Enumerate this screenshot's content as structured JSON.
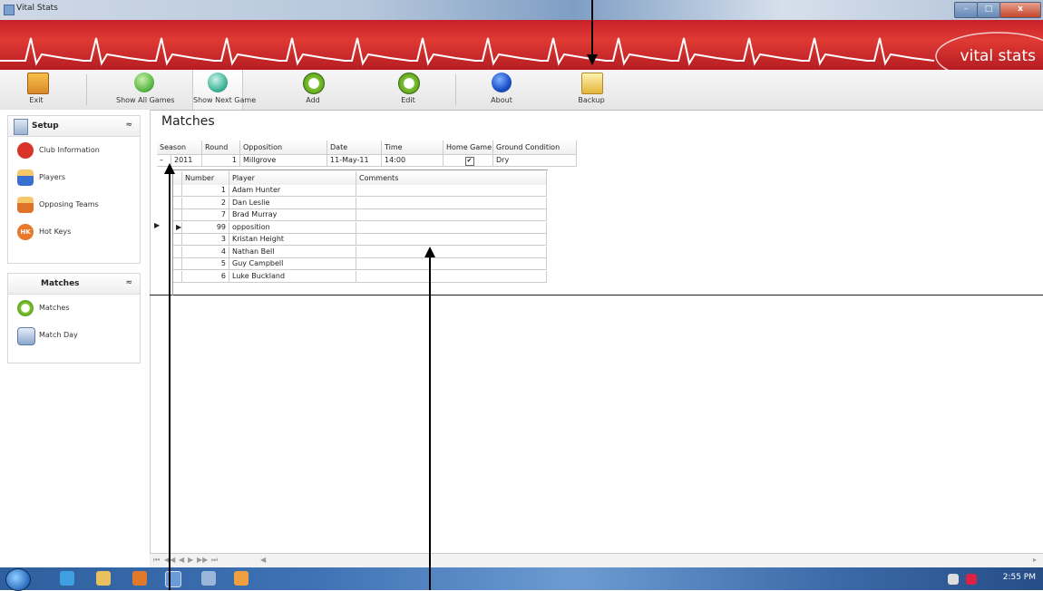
{
  "window": {
    "title": "Vital Stats",
    "min": "–",
    "max": "□",
    "close": "x"
  },
  "banner": {
    "logo_text": "vital stats",
    "color": "#d42a2a"
  },
  "toolbar": {
    "exit": "Exit",
    "show_all_games": "Show All Games",
    "show_next_game": "Show Next Game",
    "add": "Add",
    "edit": "Edit",
    "about": "About",
    "backup": "Backup"
  },
  "sidebar": {
    "setup": {
      "title": "Setup",
      "items": [
        {
          "label": "Club Information",
          "icon": "club-icon"
        },
        {
          "label": "Players",
          "icon": "players-icon"
        },
        {
          "label": "Opposing Teams",
          "icon": "teams-icon"
        },
        {
          "label": "Hot Keys",
          "icon": "hotkeys-icon",
          "badge": "HK"
        }
      ]
    },
    "matches": {
      "title": "Matches",
      "items": [
        {
          "label": "Matches",
          "icon": "clock-icon"
        },
        {
          "label": "Match Day",
          "icon": "calendar-icon"
        }
      ]
    },
    "chevron": "≈"
  },
  "main": {
    "title": "Matches",
    "columns": [
      "Season",
      "Round",
      "Opposition",
      "Date",
      "Time",
      "Home Game",
      "Ground Condition"
    ],
    "match": {
      "expander": "–",
      "season": "2011",
      "round": "1",
      "opposition": "Millgrove",
      "date": "11-May-11",
      "time": "14:00",
      "home_game": "✔",
      "ground_condition": "Dry"
    },
    "detail_columns": [
      "Number",
      "Player",
      "Comments"
    ],
    "players": [
      {
        "number": "1",
        "player": "Adam Hunter",
        "comments": ""
      },
      {
        "number": "2",
        "player": "Dan Leslie",
        "comments": ""
      },
      {
        "number": "7",
        "player": "Brad Murray",
        "comments": ""
      },
      {
        "number": "99",
        "player": "opposition",
        "comments": ""
      },
      {
        "number": "3",
        "player": "Kristan Height",
        "comments": ""
      },
      {
        "number": "4",
        "player": "Nathan Bell",
        "comments": ""
      },
      {
        "number": "5",
        "player": "Guy Campbell",
        "comments": ""
      },
      {
        "number": "6",
        "player": "Luke Buckland",
        "comments": ""
      }
    ]
  },
  "navbar": {
    "first": "⏮",
    "prev_page": "◀◀",
    "prev": "◀",
    "next": "▶",
    "next_page": "▶▶",
    "last": "⏭",
    "scroll_left": "◀",
    "scroll_right": "▸"
  },
  "taskbar": {
    "time": "2:55 PM"
  }
}
